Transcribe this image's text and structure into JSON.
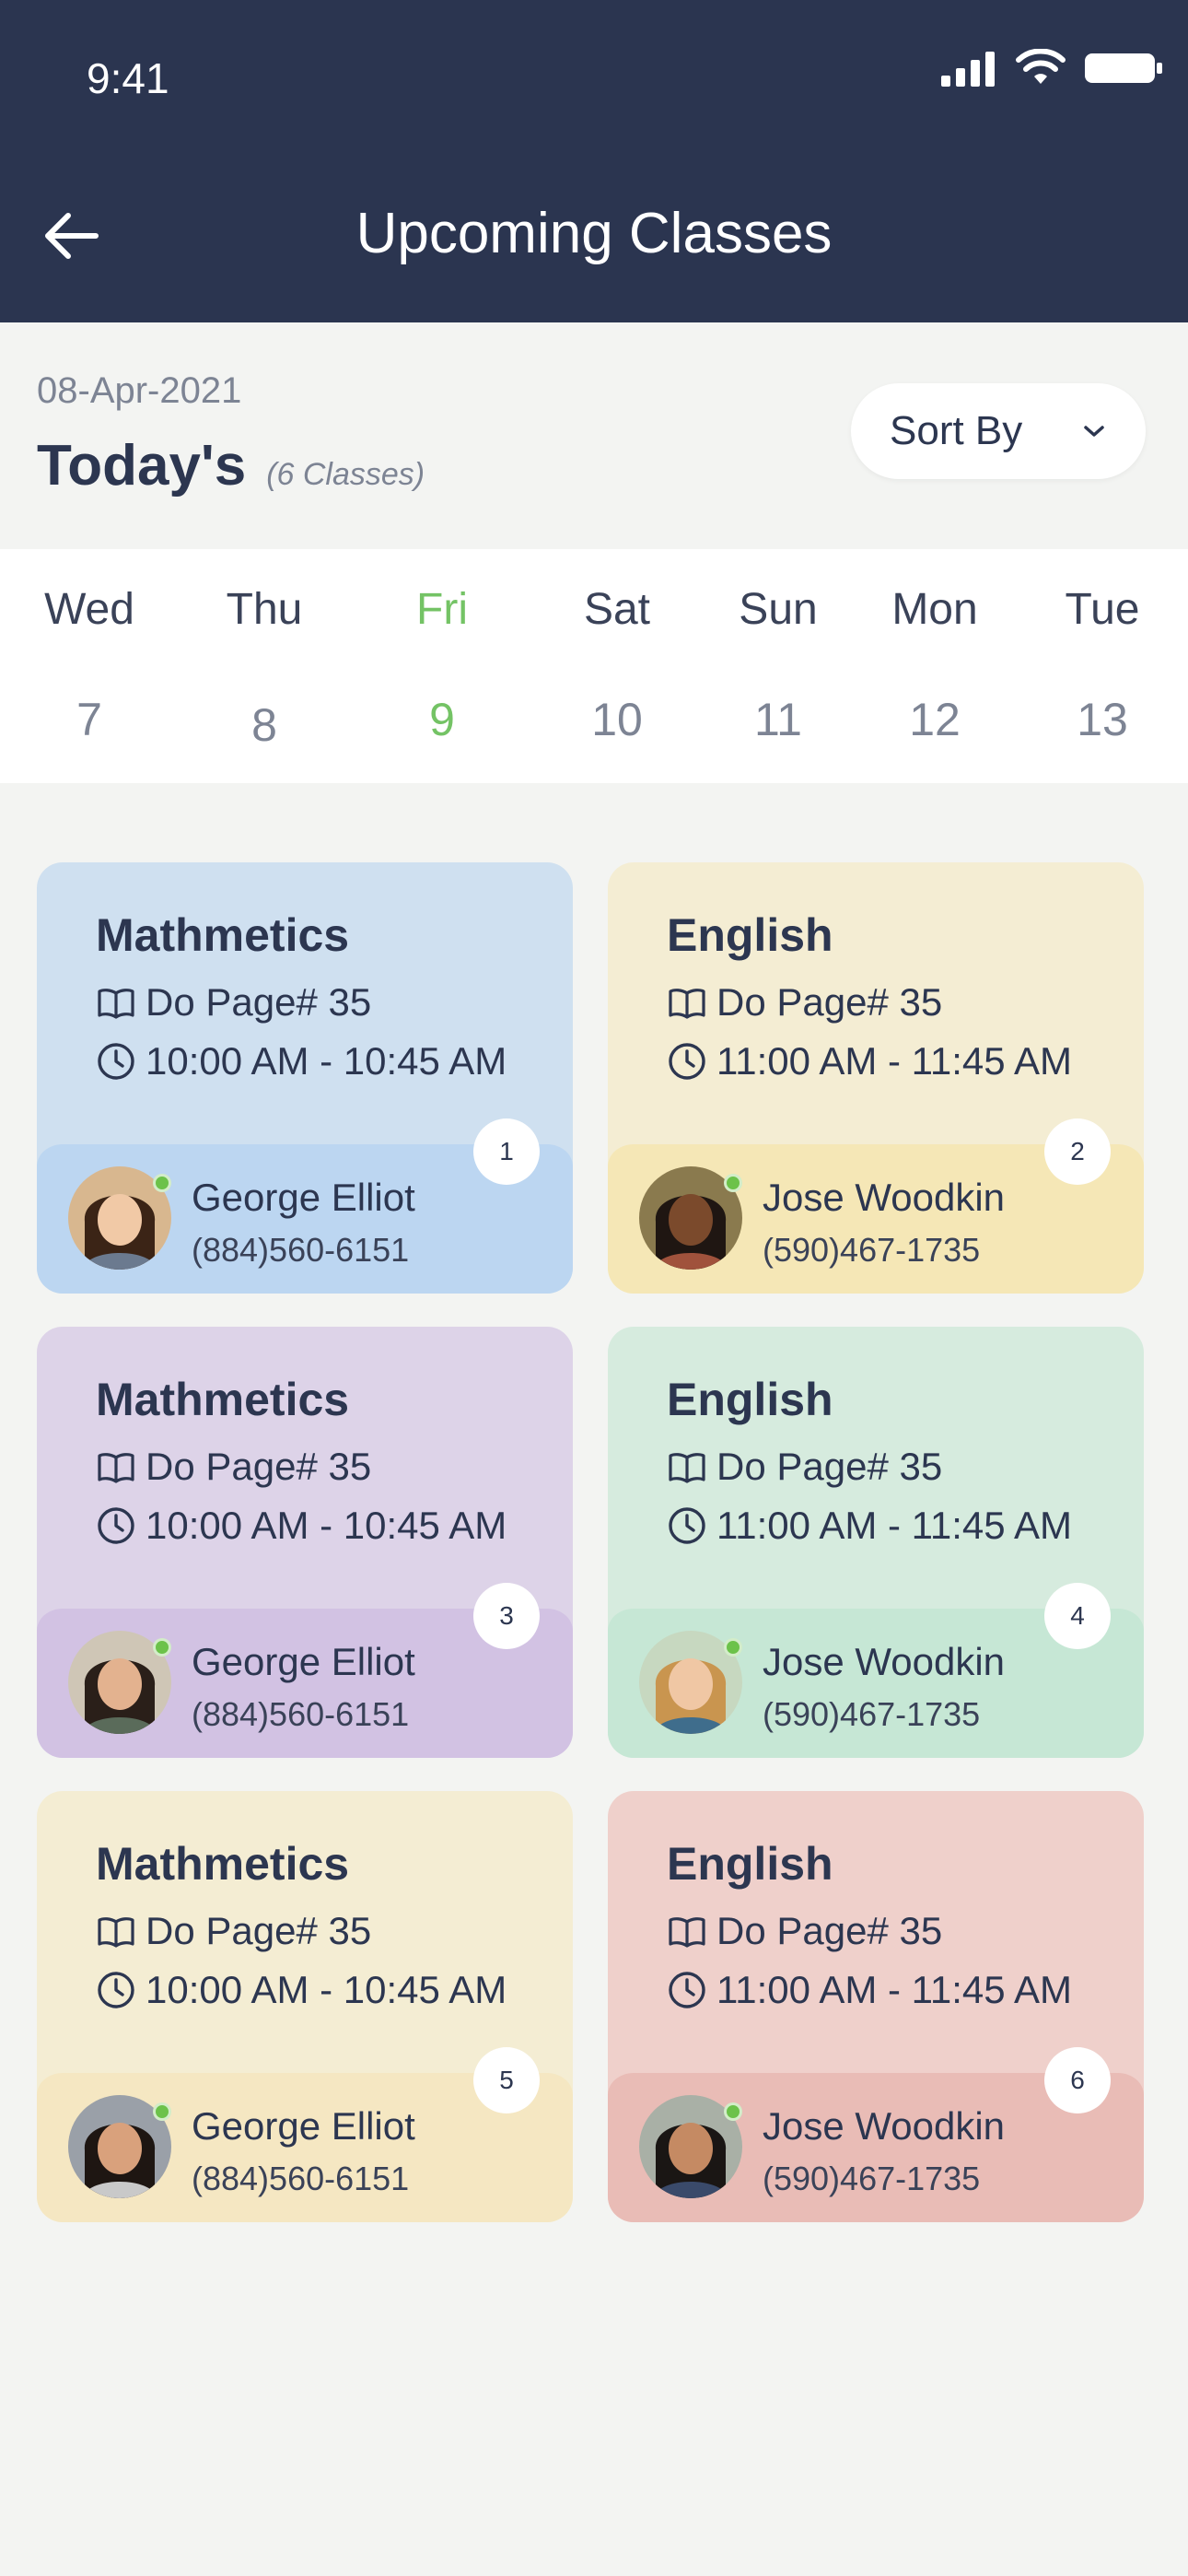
{
  "status_bar": {
    "time": "9:41"
  },
  "header": {
    "title": "Upcoming Classes"
  },
  "summary": {
    "date": "08-Apr-2021",
    "title": "Today's",
    "count": "(6 Classes)"
  },
  "sort": {
    "label": "Sort By"
  },
  "week": [
    {
      "name": "Wed",
      "num": "7"
    },
    {
      "name": "Thu",
      "num": "8"
    },
    {
      "name": "Fri",
      "num": "9",
      "active": true
    },
    {
      "name": "Sat",
      "num": "10"
    },
    {
      "name": "Sun",
      "num": "11"
    },
    {
      "name": "Mon",
      "num": "12"
    },
    {
      "name": "Tue",
      "num": "13"
    }
  ],
  "colors": {
    "header_bg": "#2b3550",
    "accent_green": "#74c365",
    "online_dot": "#6cc24a"
  },
  "classes": [
    {
      "subject": "Mathmetics",
      "task": "Do Page# 35",
      "time": "10:00 AM - 10:45 AM",
      "badge": "1",
      "teacher": "George Elliot",
      "phone": "(884)560-6151",
      "bg": "#cfe0f0",
      "foot": "#bcd6f1"
    },
    {
      "subject": "English",
      "task": "Do Page# 35",
      "time": "11:00 AM - 11:45 AM",
      "badge": "2",
      "teacher": "Jose Woodkin",
      "phone": "(590)467-1735",
      "bg": "#f4edd3",
      "foot": "#f5e7b6"
    },
    {
      "subject": "Mathmetics",
      "task": "Do Page# 35",
      "time": "10:00 AM - 10:45 AM",
      "badge": "3",
      "teacher": "George Elliot",
      "phone": "(884)560-6151",
      "bg": "#ddd3e8",
      "foot": "#d2c2e3"
    },
    {
      "subject": "English",
      "task": "Do Page# 35",
      "time": "11:00 AM - 11:45 AM",
      "badge": "4",
      "teacher": "Jose Woodkin",
      "phone": "(590)467-1735",
      "bg": "#d6ebde",
      "foot": "#c6e7d5"
    },
    {
      "subject": "Mathmetics",
      "task": "Do Page# 35",
      "time": "10:00 AM - 10:45 AM",
      "badge": "5",
      "teacher": "George Elliot",
      "phone": "(884)560-6151",
      "bg": "#f4edd3",
      "foot": "#f5e7c2"
    },
    {
      "subject": "English",
      "task": "Do Page# 35",
      "time": "11:00 AM - 11:45 AM",
      "badge": "6",
      "teacher": "Jose Woodkin",
      "phone": "(590)467-1735",
      "bg": "#efd0cb",
      "foot": "#e9bcb6"
    }
  ],
  "icons": {
    "back": "arrow-left-icon",
    "sort": "chevron-down-icon",
    "task": "book-icon",
    "time": "clock-icon"
  }
}
